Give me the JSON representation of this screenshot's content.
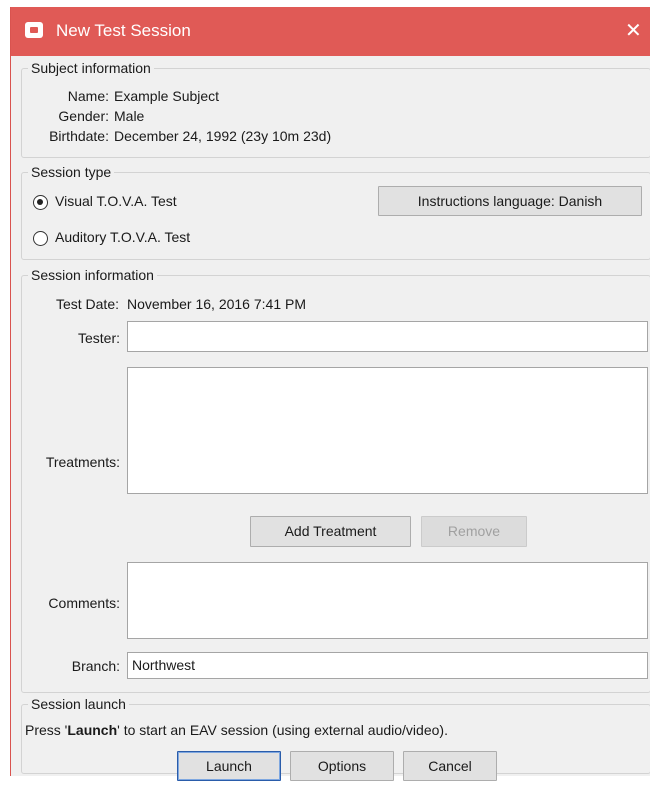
{
  "window": {
    "title": "New Test Session",
    "close_glyph": "✕"
  },
  "subject": {
    "legend": "Subject information",
    "name_label": "Name:",
    "name_value": "Example Subject",
    "gender_label": "Gender:",
    "gender_value": "Male",
    "birthdate_label": "Birthdate:",
    "birthdate_value": "December 24, 1992 (23y 10m 23d)"
  },
  "session_type": {
    "legend": "Session type",
    "options": [
      {
        "label": "Visual T.O.V.A. Test",
        "selected": true
      },
      {
        "label": "Auditory T.O.V.A. Test",
        "selected": false
      }
    ],
    "language_button": "Instructions language: Danish"
  },
  "session_info": {
    "legend": "Session information",
    "test_date_label": "Test Date:",
    "test_date_value": "November 16, 2016 7:41 PM",
    "tester_label": "Tester:",
    "tester_value": "",
    "treatments_label": "Treatments:",
    "add_treatment_button": "Add Treatment",
    "remove_button": "Remove",
    "comments_label": "Comments:",
    "comments_value": "",
    "branch_label": "Branch:",
    "branch_value": "Northwest"
  },
  "session_launch": {
    "legend": "Session launch",
    "text_prefix": "Press '",
    "text_bold": "Launch",
    "text_suffix": "' to start an EAV session (using external audio/video).",
    "launch_button": "Launch",
    "options_button": "Options",
    "cancel_button": "Cancel"
  },
  "colors": {
    "titlebar": "#e05a56",
    "dialog_bg": "#f0f0f0",
    "focus_border": "#2a5caa"
  }
}
